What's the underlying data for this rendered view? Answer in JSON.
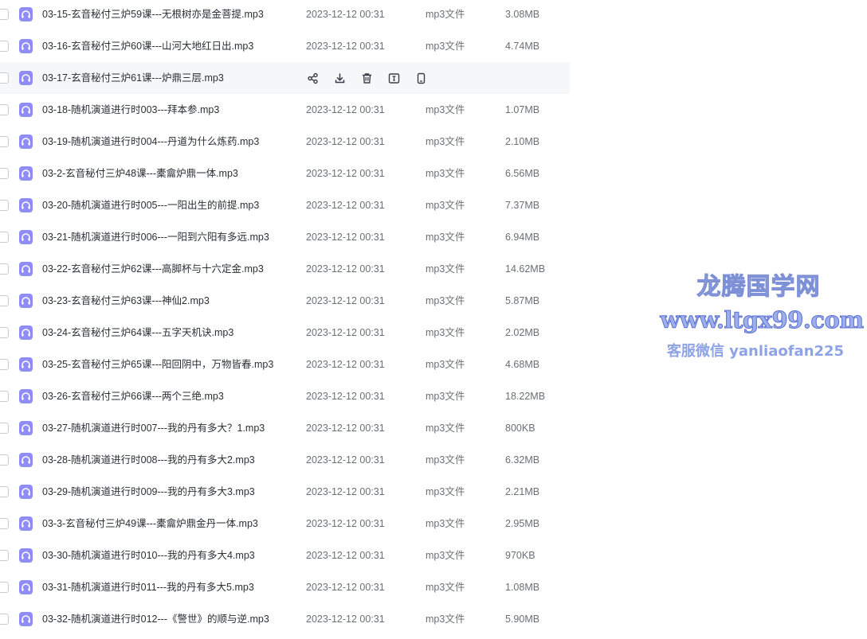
{
  "file_list": {
    "rows": [
      {
        "name": "03-15-玄音秘付三炉59课---无根树亦是金菩提.mp3",
        "date": "2023-12-12 00:31",
        "type": "mp3文件",
        "size": "3.08MB"
      },
      {
        "name": "03-16-玄音秘付三炉60课---山河大地红日出.mp3",
        "date": "2023-12-12 00:31",
        "type": "mp3文件",
        "size": "4.74MB"
      },
      {
        "name": "03-17-玄音秘付三炉61课---炉鼎三层.mp3",
        "date": "",
        "type": "",
        "size": "",
        "hover": true
      },
      {
        "name": "03-18-随机演道进行时003---拜本参.mp3",
        "date": "2023-12-12 00:31",
        "type": "mp3文件",
        "size": "1.07MB"
      },
      {
        "name": "03-19-随机演道进行时004---丹道为什么炼药.mp3",
        "date": "2023-12-12 00:31",
        "type": "mp3文件",
        "size": "2.10MB"
      },
      {
        "name": "03-2-玄音秘付三炉48课---橐龠炉鼎一体.mp3",
        "date": "2023-12-12 00:31",
        "type": "mp3文件",
        "size": "6.56MB"
      },
      {
        "name": "03-20-随机演道进行时005---一阳出生的前提.mp3",
        "date": "2023-12-12 00:31",
        "type": "mp3文件",
        "size": "7.37MB"
      },
      {
        "name": "03-21-随机演道进行时006---一阳到六阳有多远.mp3",
        "date": "2023-12-12 00:31",
        "type": "mp3文件",
        "size": "6.94MB"
      },
      {
        "name": "03-22-玄音秘付三炉62课---高脚杯与十六定金.mp3",
        "date": "2023-12-12 00:31",
        "type": "mp3文件",
        "size": "14.62MB"
      },
      {
        "name": "03-23-玄音秘付三炉63课---神仙2.mp3",
        "date": "2023-12-12 00:31",
        "type": "mp3文件",
        "size": "5.87MB"
      },
      {
        "name": "03-24-玄音秘付三炉64课---五字天机诀.mp3",
        "date": "2023-12-12 00:31",
        "type": "mp3文件",
        "size": "2.02MB"
      },
      {
        "name": "03-25-玄音秘付三炉65课---阳回阴中，万物皆春.mp3",
        "date": "2023-12-12 00:31",
        "type": "mp3文件",
        "size": "4.68MB"
      },
      {
        "name": "03-26-玄音秘付三炉66课---两个三绝.mp3",
        "date": "2023-12-12 00:31",
        "type": "mp3文件",
        "size": "18.22MB"
      },
      {
        "name": "03-27-随机演道进行时007---我的丹有多大？1.mp3",
        "date": "2023-12-12 00:31",
        "type": "mp3文件",
        "size": "800KB"
      },
      {
        "name": "03-28-随机演道进行时008---我的丹有多大2.mp3",
        "date": "2023-12-12 00:31",
        "type": "mp3文件",
        "size": "6.32MB"
      },
      {
        "name": "03-29-随机演道进行时009---我的丹有多大3.mp3",
        "date": "2023-12-12 00:31",
        "type": "mp3文件",
        "size": "2.21MB"
      },
      {
        "name": "03-3-玄音秘付三炉49课---橐龠炉鼎金丹一体.mp3",
        "date": "2023-12-12 00:31",
        "type": "mp3文件",
        "size": "2.95MB"
      },
      {
        "name": "03-30-随机演道进行时010---我的丹有多大4.mp3",
        "date": "2023-12-12 00:31",
        "type": "mp3文件",
        "size": "970KB"
      },
      {
        "name": "03-31-随机演道进行时011---我的丹有多大5.mp3",
        "date": "2023-12-12 00:31",
        "type": "mp3文件",
        "size": "1.08MB"
      },
      {
        "name": "03-32-随机演道进行时012---《警世》的顺与逆.mp3",
        "date": "2023-12-12 00:31",
        "type": "mp3文件",
        "size": "5.90MB"
      }
    ],
    "hover_actions": [
      "share-icon",
      "download-icon",
      "delete-icon",
      "rename-icon",
      "mobile-icon"
    ],
    "file_icon": "headphones-icon",
    "accent_color": "#8f8cf5"
  },
  "watermark": {
    "title": "龙腾国学网",
    "url": "www.ltgx99.com",
    "contact": "客服微信 yanliaofan225"
  }
}
